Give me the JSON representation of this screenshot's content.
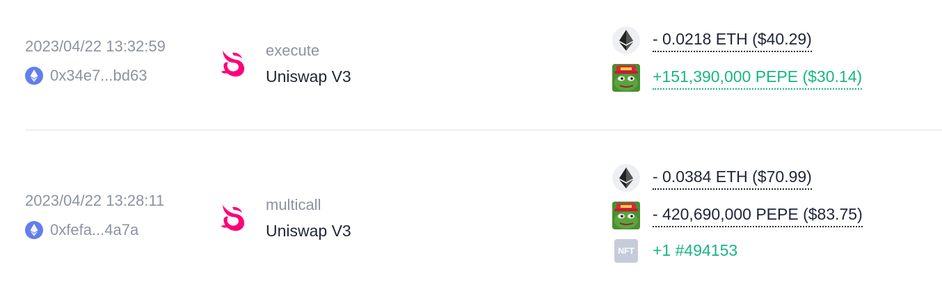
{
  "transactions": [
    {
      "time": "2023/04/22 13:32:59",
      "hash": "0x34e7...bd63",
      "method": "execute",
      "protocol": "Uniswap V3",
      "transfers": [
        {
          "icon": "eth-icon",
          "text": "- 0.0218 ETH ($40.29)",
          "direction": "out"
        },
        {
          "icon": "pepe-icon",
          "text": "+151,390,000 PEPE ($30.14)",
          "direction": "in"
        }
      ]
    },
    {
      "time": "2023/04/22 13:28:11",
      "hash": "0xfefa...4a7a",
      "method": "multicall",
      "protocol": "Uniswap V3",
      "transfers": [
        {
          "icon": "eth-icon",
          "text": "- 0.0384 ETH ($70.99)",
          "direction": "out"
        },
        {
          "icon": "pepe-icon",
          "text": "- 420,690,000 PEPE ($83.75)",
          "direction": "out"
        },
        {
          "icon": "nft-icon",
          "text": "+1 #494153",
          "direction": "in",
          "icon_label": "NFT"
        }
      ]
    }
  ],
  "colors": {
    "muted": "#8d93a0",
    "text": "#1f2535",
    "positive": "#19b584",
    "uniswap_pink": "#ff007a",
    "chain_blue": "#627eea"
  }
}
